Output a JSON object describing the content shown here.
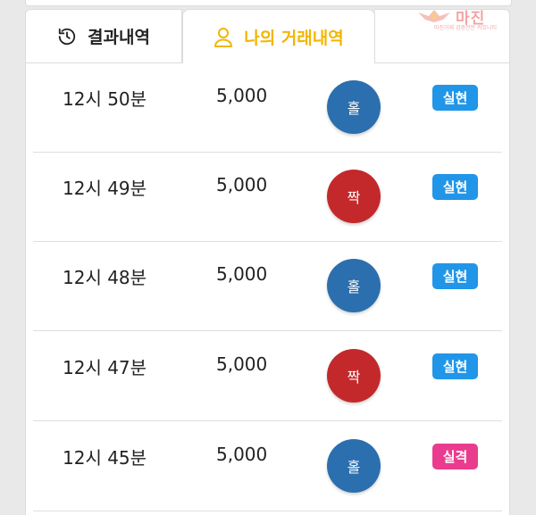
{
  "tabs": {
    "history_label": "결과내역",
    "mine_label": "나의 거래내역",
    "history_color": "#222222",
    "mine_color": "#f2b600"
  },
  "records": [
    {
      "time": "12시 50분",
      "amount": "5,000",
      "pick": "홀",
      "pick_color": "#2b6fae",
      "result": "실현",
      "result_color": "#2196e8"
    },
    {
      "time": "12시 49분",
      "amount": "5,000",
      "pick": "짝",
      "pick_color": "#c3292b",
      "result": "실현",
      "result_color": "#2196e8"
    },
    {
      "time": "12시 48분",
      "amount": "5,000",
      "pick": "홀",
      "pick_color": "#2b6fae",
      "result": "실현",
      "result_color": "#2196e8"
    },
    {
      "time": "12시 47분",
      "amount": "5,000",
      "pick": "짝",
      "pick_color": "#c3292b",
      "result": "실현",
      "result_color": "#2196e8"
    },
    {
      "time": "12시 45분",
      "amount": "5,000",
      "pick": "홀",
      "pick_color": "#2b6fae",
      "result": "실격",
      "result_color": "#ea3c8e"
    }
  ],
  "watermark": {
    "text": "마진",
    "subtitle": "마진거래 검증전문 커뮤니티"
  }
}
